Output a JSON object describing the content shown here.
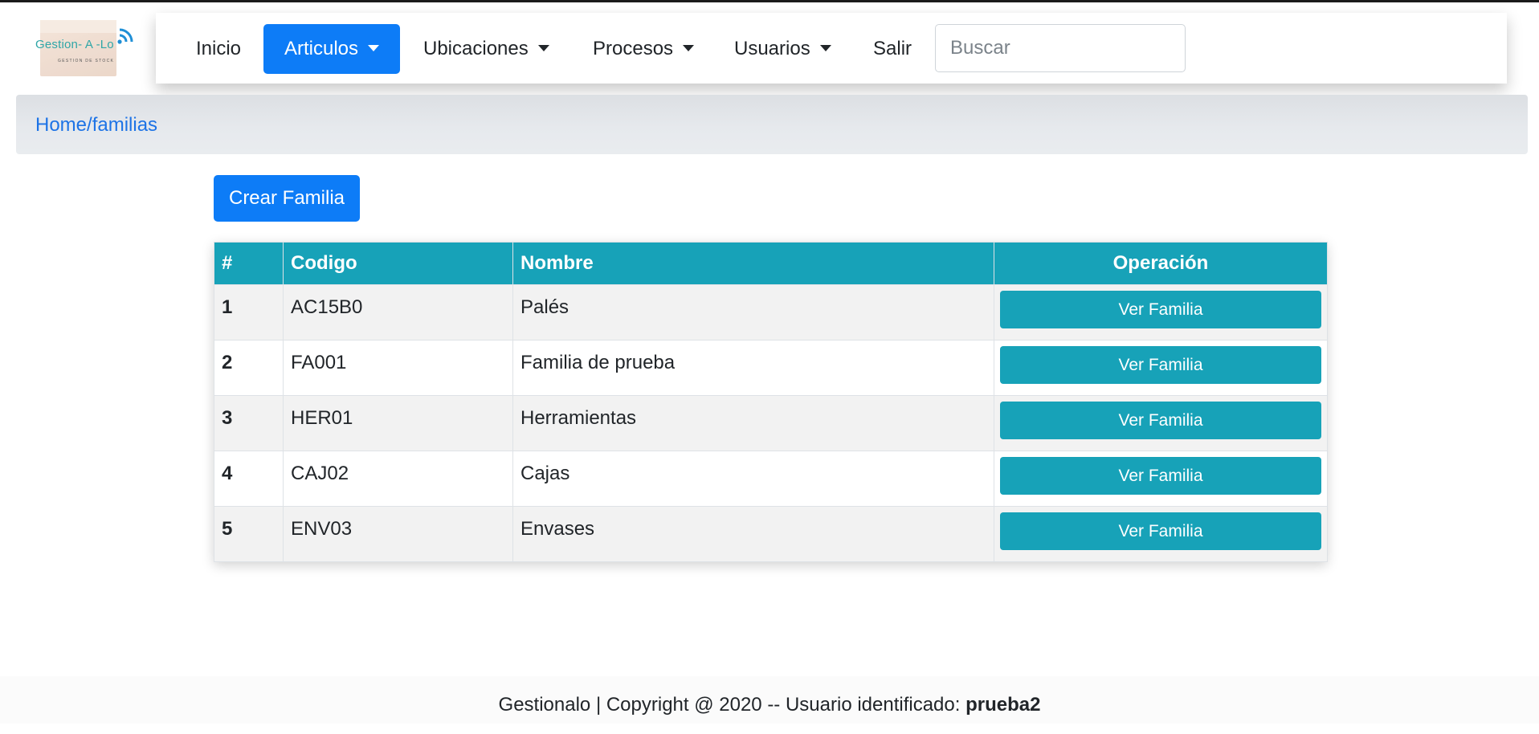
{
  "brand": {
    "name": "Gestion- A -Lo",
    "tagline": "GESTION DE STOCK"
  },
  "navbar": {
    "items": [
      {
        "label": "Inicio",
        "dropdown": false,
        "active": false
      },
      {
        "label": "Articulos",
        "dropdown": true,
        "active": true
      },
      {
        "label": "Ubicaciones",
        "dropdown": true,
        "active": false
      },
      {
        "label": "Procesos",
        "dropdown": true,
        "active": false
      },
      {
        "label": "Usuarios",
        "dropdown": true,
        "active": false
      },
      {
        "label": "Salir",
        "dropdown": false,
        "active": false
      }
    ],
    "search_placeholder": "Buscar",
    "search_value": ""
  },
  "breadcrumb": "Home/familias",
  "create_button": "Crear Familia",
  "table": {
    "headers": [
      "#",
      "Codigo",
      "Nombre",
      "Operación"
    ],
    "rows": [
      {
        "num": "1",
        "codigo": "AC15B0",
        "nombre": "Palés",
        "action": "Ver Familia"
      },
      {
        "num": "2",
        "codigo": "FA001",
        "nombre": "Familia de prueba",
        "action": "Ver Familia"
      },
      {
        "num": "3",
        "codigo": "HER01",
        "nombre": "Herramientas",
        "action": "Ver Familia"
      },
      {
        "num": "4",
        "codigo": "CAJ02",
        "nombre": "Cajas",
        "action": "Ver Familia"
      },
      {
        "num": "5",
        "codigo": "ENV03",
        "nombre": "Envases",
        "action": "Ver Familia"
      }
    ]
  },
  "footer": {
    "text": "Gestionalo | Copyright @ 2020 -- Usuario identificado: ",
    "user": "prueba2"
  },
  "colors": {
    "primary": "#0d7cf7",
    "info": "#17a2b8",
    "breadcrumb_link": "#1d73e6",
    "brand_teal": "#2fa6a7"
  },
  "icons": {
    "logo": "box-logo-icon",
    "signal": "wifi-signal-icon",
    "dropdown": "caret-down-icon"
  }
}
